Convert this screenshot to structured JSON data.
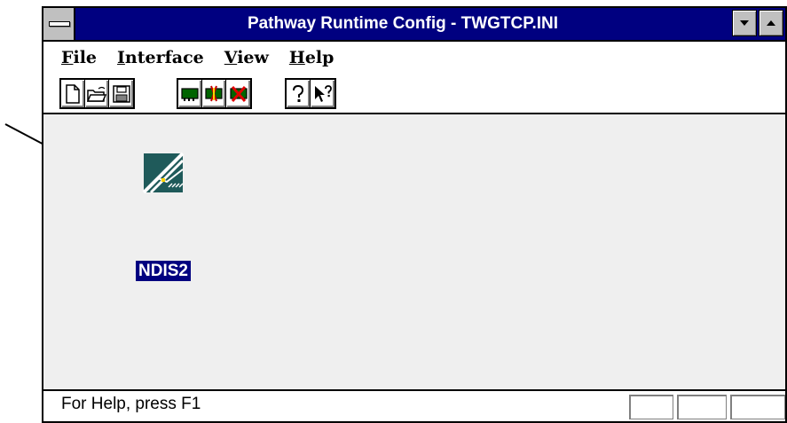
{
  "window": {
    "title": "Pathway Runtime Config - TWGTCP.INI"
  },
  "menu": {
    "items": [
      {
        "label": "File",
        "mnemonic": "F",
        "rest": "ile"
      },
      {
        "label": "Interface",
        "mnemonic": "I",
        "rest": "nterface"
      },
      {
        "label": "View",
        "mnemonic": "V",
        "rest": "iew"
      },
      {
        "label": "Help",
        "mnemonic": "H",
        "rest": "elp"
      }
    ]
  },
  "toolbar": {
    "groups": [
      [
        "new-file-icon",
        "open-folder-icon",
        "save-disk-icon"
      ],
      [
        "add-interface-icon",
        "configure-interface-icon",
        "remove-interface-icon"
      ],
      [
        "help-icon",
        "context-help-icon"
      ]
    ]
  },
  "workspace": {
    "interface_icon": "network-adapter-icon",
    "interface_label": "NDIS2"
  },
  "status": {
    "text": "For Help, press F1"
  },
  "colors": {
    "title_bg": "#000080",
    "selection_bg": "#000080",
    "client_bg": "#efefef",
    "adapter_icon": "#1f5a5a"
  }
}
